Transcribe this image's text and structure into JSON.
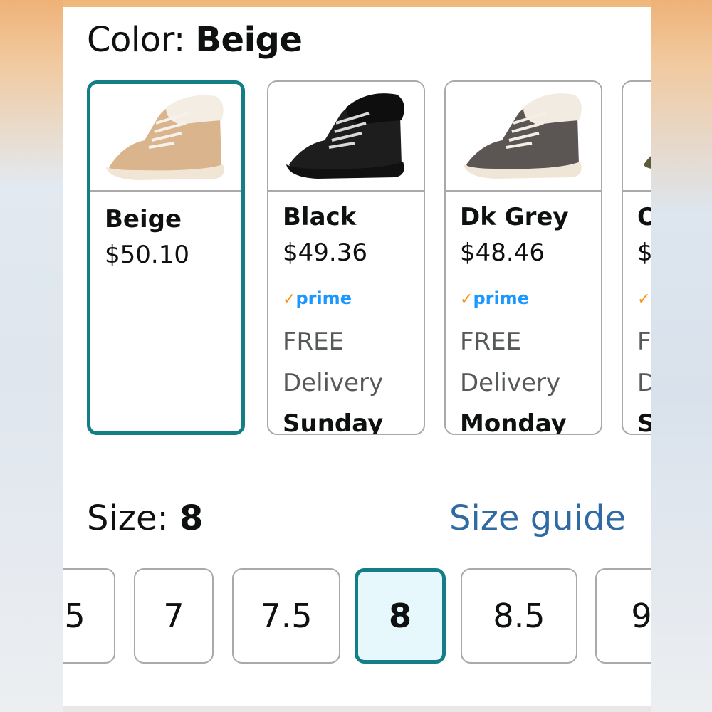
{
  "color_selector": {
    "label": "Color:",
    "selected": "Beige"
  },
  "swatches": [
    {
      "name": "Beige",
      "price": "$50.10",
      "prime": "",
      "free": "",
      "delivery": "",
      "day": ""
    },
    {
      "name": "Black",
      "price": "$49.36",
      "prime": "prime",
      "free": "FREE",
      "delivery": "Delivery",
      "day": "Sunday"
    },
    {
      "name": "Dk Grey",
      "price": "$48.46",
      "prime": "prime",
      "free": "FREE",
      "delivery": "Delivery",
      "day": "Monday"
    },
    {
      "name": "O",
      "price": "$",
      "prime": "prime",
      "free": "F",
      "delivery": "D",
      "day": "S"
    }
  ],
  "size_selector": {
    "label": "Size:",
    "selected": "8",
    "guide_link": "Size guide"
  },
  "sizes": [
    "5",
    "7",
    "7.5",
    "8",
    "8.5",
    "9"
  ],
  "colors": {
    "accent": "#137e86",
    "link": "#2f6aa3",
    "prime": "#1a98ff",
    "prime_check": "#f7941d"
  }
}
